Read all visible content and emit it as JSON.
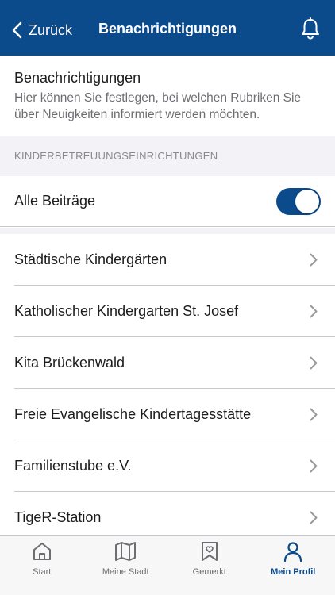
{
  "header": {
    "back_label": "Zurück",
    "title": "Benachrichtigungen"
  },
  "intro": {
    "title": "Benachrichtigungen",
    "text": "Hier können Sie festlegen, bei welchen Rubriken Sie über Neuigkeiten informiert werden möchten."
  },
  "section": {
    "header": "KINDERBETREUUNGSEINRICHTUNGEN",
    "toggle_label": "Alle Beiträge",
    "toggle_on": true
  },
  "list": {
    "items": [
      {
        "label": "Städtische Kindergärten"
      },
      {
        "label": "Katholischer Kindergarten St. Josef"
      },
      {
        "label": "Kita Brückenwald"
      },
      {
        "label": "Freie Evangelische Kindertagesstätte"
      },
      {
        "label": "Familienstube e.V."
      },
      {
        "label": "TigeR-Station"
      }
    ]
  },
  "tabs": [
    {
      "label": "Start",
      "icon": "home-icon"
    },
    {
      "label": "Meine Stadt",
      "icon": "map-icon"
    },
    {
      "label": "Gemerkt",
      "icon": "bookmark-heart-icon"
    },
    {
      "label": "Mein Profil",
      "icon": "person-icon",
      "active": true
    }
  ],
  "colors": {
    "brand": "#0b4a8b",
    "inactive": "#6d6d72"
  }
}
